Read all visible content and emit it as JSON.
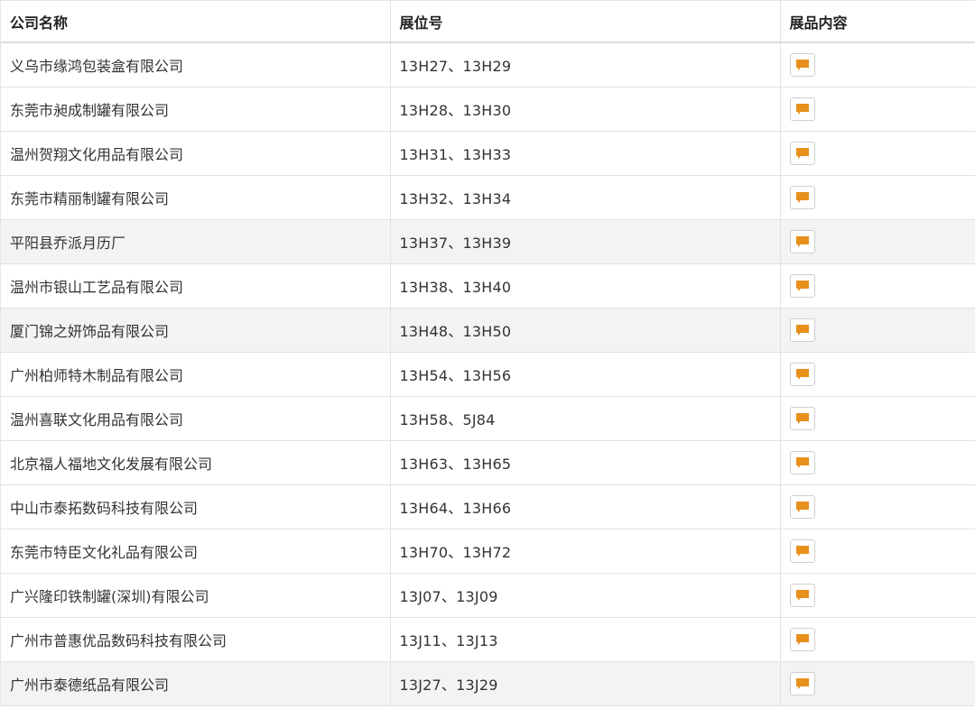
{
  "table": {
    "headers": {
      "company": "公司名称",
      "booth": "展位号",
      "products": "展品内容"
    },
    "icon": "speech-bubble-icon",
    "accent_color": "#e8901c",
    "rows": [
      {
        "company": "义乌市缘鸿包装盒有限公司",
        "booth": "13H27、13H29"
      },
      {
        "company": "东莞市昶成制罐有限公司",
        "booth": "13H28、13H30"
      },
      {
        "company": "温州贺翔文化用品有限公司",
        "booth": "13H31、13H33"
      },
      {
        "company": "东莞市精丽制罐有限公司",
        "booth": "13H32、13H34"
      },
      {
        "company": "平阳县乔派月历厂",
        "booth": "13H37、13H39"
      },
      {
        "company": "温州市银山工艺品有限公司",
        "booth": "13H38、13H40"
      },
      {
        "company": "厦门锦之妍饰品有限公司",
        "booth": "13H48、13H50"
      },
      {
        "company": "广州柏师特木制品有限公司",
        "booth": "13H54、13H56"
      },
      {
        "company": "温州喜联文化用品有限公司",
        "booth": "13H58、5J84"
      },
      {
        "company": "北京福人福地文化发展有限公司",
        "booth": "13H63、13H65"
      },
      {
        "company": "中山市泰拓数码科技有限公司",
        "booth": "13H64、13H66"
      },
      {
        "company": "东莞市特臣文化礼品有限公司",
        "booth": "13H70、13H72"
      },
      {
        "company": "广兴隆印铁制罐(深圳)有限公司",
        "booth": "13J07、13J09"
      },
      {
        "company": "广州市普惠优品数码科技有限公司",
        "booth": "13J11、13J13"
      },
      {
        "company": "广州市泰德纸品有限公司",
        "booth": "13J27、13J29"
      }
    ]
  }
}
